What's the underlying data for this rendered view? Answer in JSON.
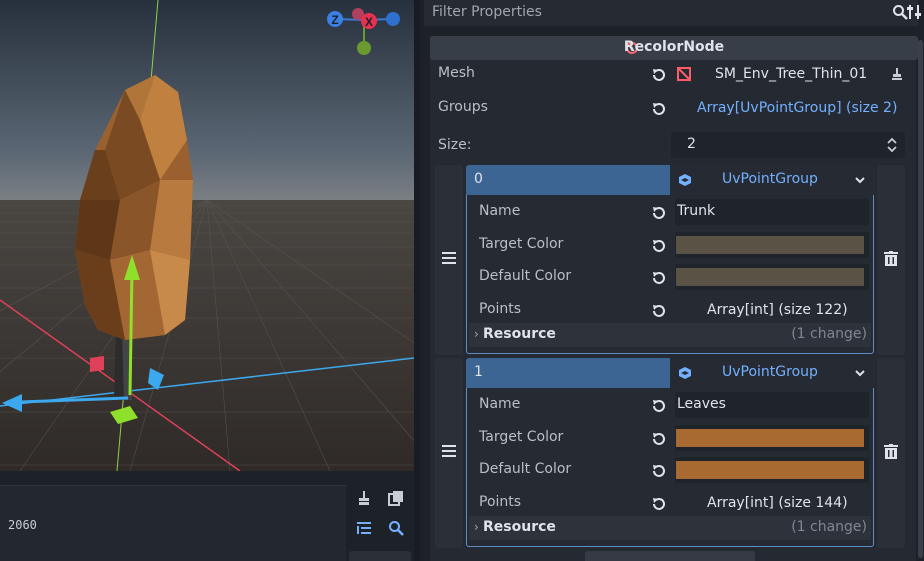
{
  "viewport": {
    "gizmo_labels": {
      "z": "Z",
      "x": "X"
    }
  },
  "output": {
    "text": "2060"
  },
  "inspector": {
    "filter_placeholder": "Filter Properties",
    "node_title": "RecolorNode",
    "mesh_label": "Mesh",
    "mesh_value": "SM_Env_Tree_Thin_01",
    "groups_label": "Groups",
    "groups_value": "Array[UvPointGroup] (size 2)",
    "size_label": "Size:",
    "size_value": "2",
    "groups": [
      {
        "index": "0",
        "type": "UvPointGroup",
        "name_label": "Name",
        "name_value": "Trunk",
        "target_color_label": "Target Color",
        "target_color": "#5a5244",
        "default_color_label": "Default Color",
        "default_color": "#5a5244",
        "points_label": "Points",
        "points_value": "Array[int] (size 122)",
        "resource_label": "Resource",
        "resource_changes": "(1 change)"
      },
      {
        "index": "1",
        "type": "UvPointGroup",
        "name_label": "Name",
        "name_value": "Leaves",
        "target_color_label": "Target Color",
        "target_color": "#a86a30",
        "default_color_label": "Default Color",
        "default_color": "#a86a30",
        "points_label": "Points",
        "points_value": "Array[int] (size 144)",
        "resource_label": "Resource",
        "resource_changes": "(1 change)"
      }
    ]
  }
}
